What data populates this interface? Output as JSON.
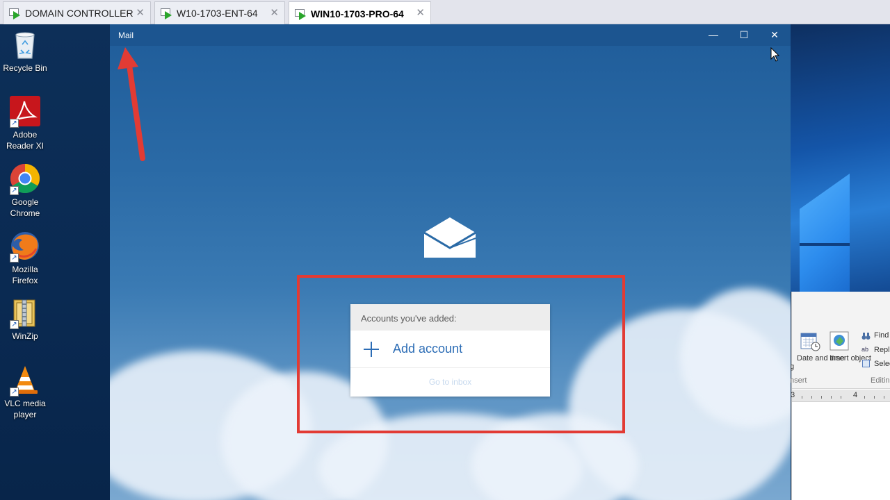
{
  "vm_tabs": [
    {
      "label": "DOMAIN CONTROLLER",
      "active": false,
      "close": "✕"
    },
    {
      "label": "W10-1703-ENT-64",
      "active": false,
      "close": "✕"
    },
    {
      "label": "WIN10-1703-PRO-64",
      "active": true,
      "close": "✕"
    }
  ],
  "desktop": {
    "icons": [
      {
        "label": "Recycle Bin",
        "icon": "recycle-bin-icon"
      },
      {
        "label": "Adobe Reader XI",
        "icon": "adobe-reader-icon"
      },
      {
        "label": "Google Chrome",
        "icon": "chrome-icon"
      },
      {
        "label": "Mozilla Firefox",
        "icon": "firefox-icon"
      },
      {
        "label": "WinZip",
        "icon": "winzip-icon"
      },
      {
        "label": "VLC media player",
        "icon": "vlc-icon"
      }
    ]
  },
  "mail": {
    "title": "Mail",
    "minimize": "—",
    "maximize": "☐",
    "close": "✕",
    "accounts_header": "Accounts you've added:",
    "add_account": "Add account",
    "go_to_inbox": "Go to inbox"
  },
  "word": {
    "date_time": "Date and time",
    "insert_object": "Insert object",
    "find": "Find",
    "replace": "Replac",
    "select": "Selec",
    "group_insert": "nsert",
    "group_editing": "Editin",
    "ruler_3": "3",
    "ruler_4": "4",
    "prev_label": "g"
  },
  "colors": {
    "highlight": "#e23b34",
    "accent": "#2b6cb5",
    "titlebar": "#1c5590"
  }
}
